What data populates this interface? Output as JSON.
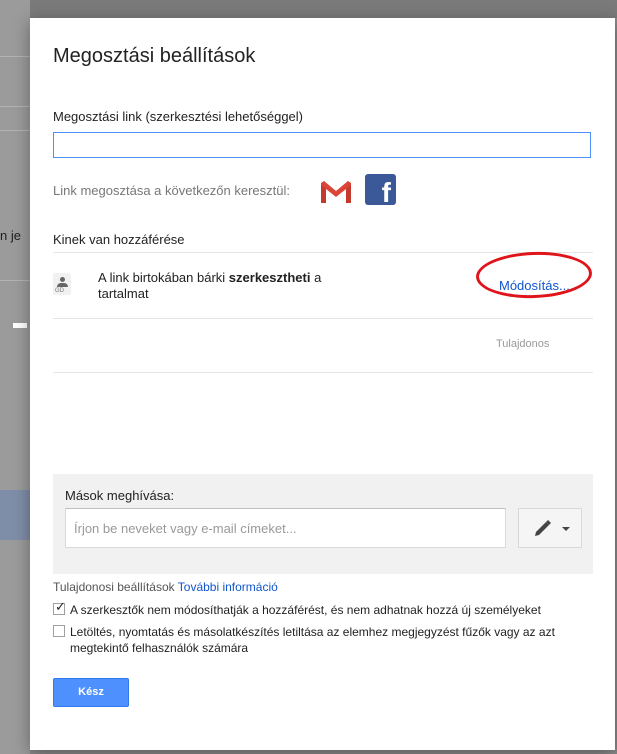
{
  "background": {
    "partial_text": "n je"
  },
  "dialog": {
    "title": "Megosztási beállítások",
    "share_link": {
      "label": "Megosztási link (szerkesztési lehetőséggel)",
      "value": ""
    },
    "share_via": {
      "label": "Link megosztása a következőn keresztül:",
      "gmail_icon": "gmail-icon",
      "facebook_icon": "facebook-icon",
      "facebook_glyph": "f"
    },
    "access": {
      "heading": "Kinek van hozzáférése",
      "entry": {
        "text_before": "A link birtokában bárki ",
        "text_bold": "szerkesztheti",
        "text_after": " a tartalmat",
        "action_label": "Módosítás..."
      },
      "owner_label": "Tulajdonos"
    },
    "invite": {
      "label": "Mások meghívása:",
      "placeholder": "Írjon be neveket vagy e-mail címeket..."
    },
    "owner_settings": {
      "label": "Tulajdonosi beállítások",
      "more_info_link": "További információ"
    },
    "options": [
      {
        "label": "A szerkesztők nem módosíthatják a hozzáférést, és nem adhatnak hozzá új személyeket",
        "checked": true
      },
      {
        "label": "Letöltés, nyomtatás és másolatkészítés letiltása az elemhez megjegyzést fűzők vagy az azt megtekintő felhasználók számára",
        "checked": false
      }
    ],
    "done_button": "Kész"
  },
  "colors": {
    "accent_blue": "#4d90fe",
    "link_blue": "#1155cc",
    "annotation_red": "#e0141b",
    "facebook_blue": "#3b5998"
  }
}
